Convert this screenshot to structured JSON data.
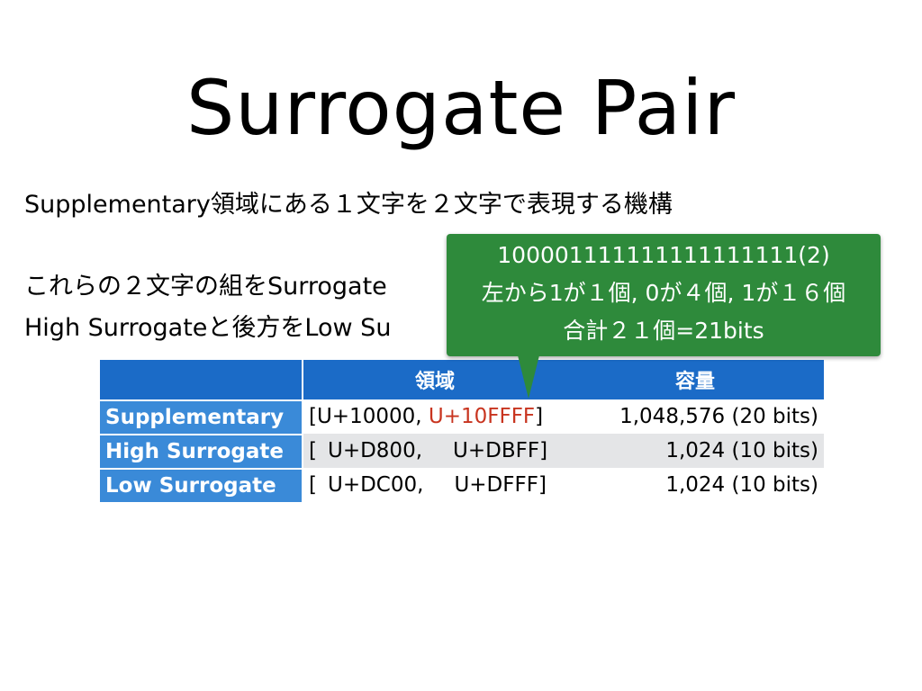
{
  "slide": {
    "title": "Surrogate Pair",
    "lines": [
      "Supplementary領域にある１文字を２文字で表現する機構",
      "これらの２文字の組をSurrogate",
      "High Surrogateと後方をLow Su"
    ]
  },
  "table": {
    "headers": [
      "",
      "領域",
      "容量"
    ],
    "rows": [
      {
        "name": "Supplementary",
        "range_open": "[U+10000,",
        "range_close": "U+10FFFF",
        "range_end": "]",
        "capacity": "1,048,576 (20 bits)"
      },
      {
        "name": "High Surrogate",
        "range_open": "[",
        "range_start": "U+D800,",
        "range_close": "U+DBFF]",
        "capacity": "1,024 (10 bits)"
      },
      {
        "name": "Low Surrogate",
        "range_open": "[",
        "range_start": "U+DC00,",
        "range_close": "U+DFFF]",
        "capacity": "1,024 (10 bits)"
      }
    ]
  },
  "callout": {
    "line1": "100001111111111111111(2)",
    "line2": "左から1が１個, 0が４個, 1が１６個",
    "line3": "合計２１個=21bits"
  },
  "colors": {
    "header_blue": "#1b6bc7",
    "row_header_blue": "#3a8ad8",
    "callout_green": "#2e8a3b",
    "highlight_red": "#c8341f",
    "alt_row_gray": "#e4e5e7"
  }
}
